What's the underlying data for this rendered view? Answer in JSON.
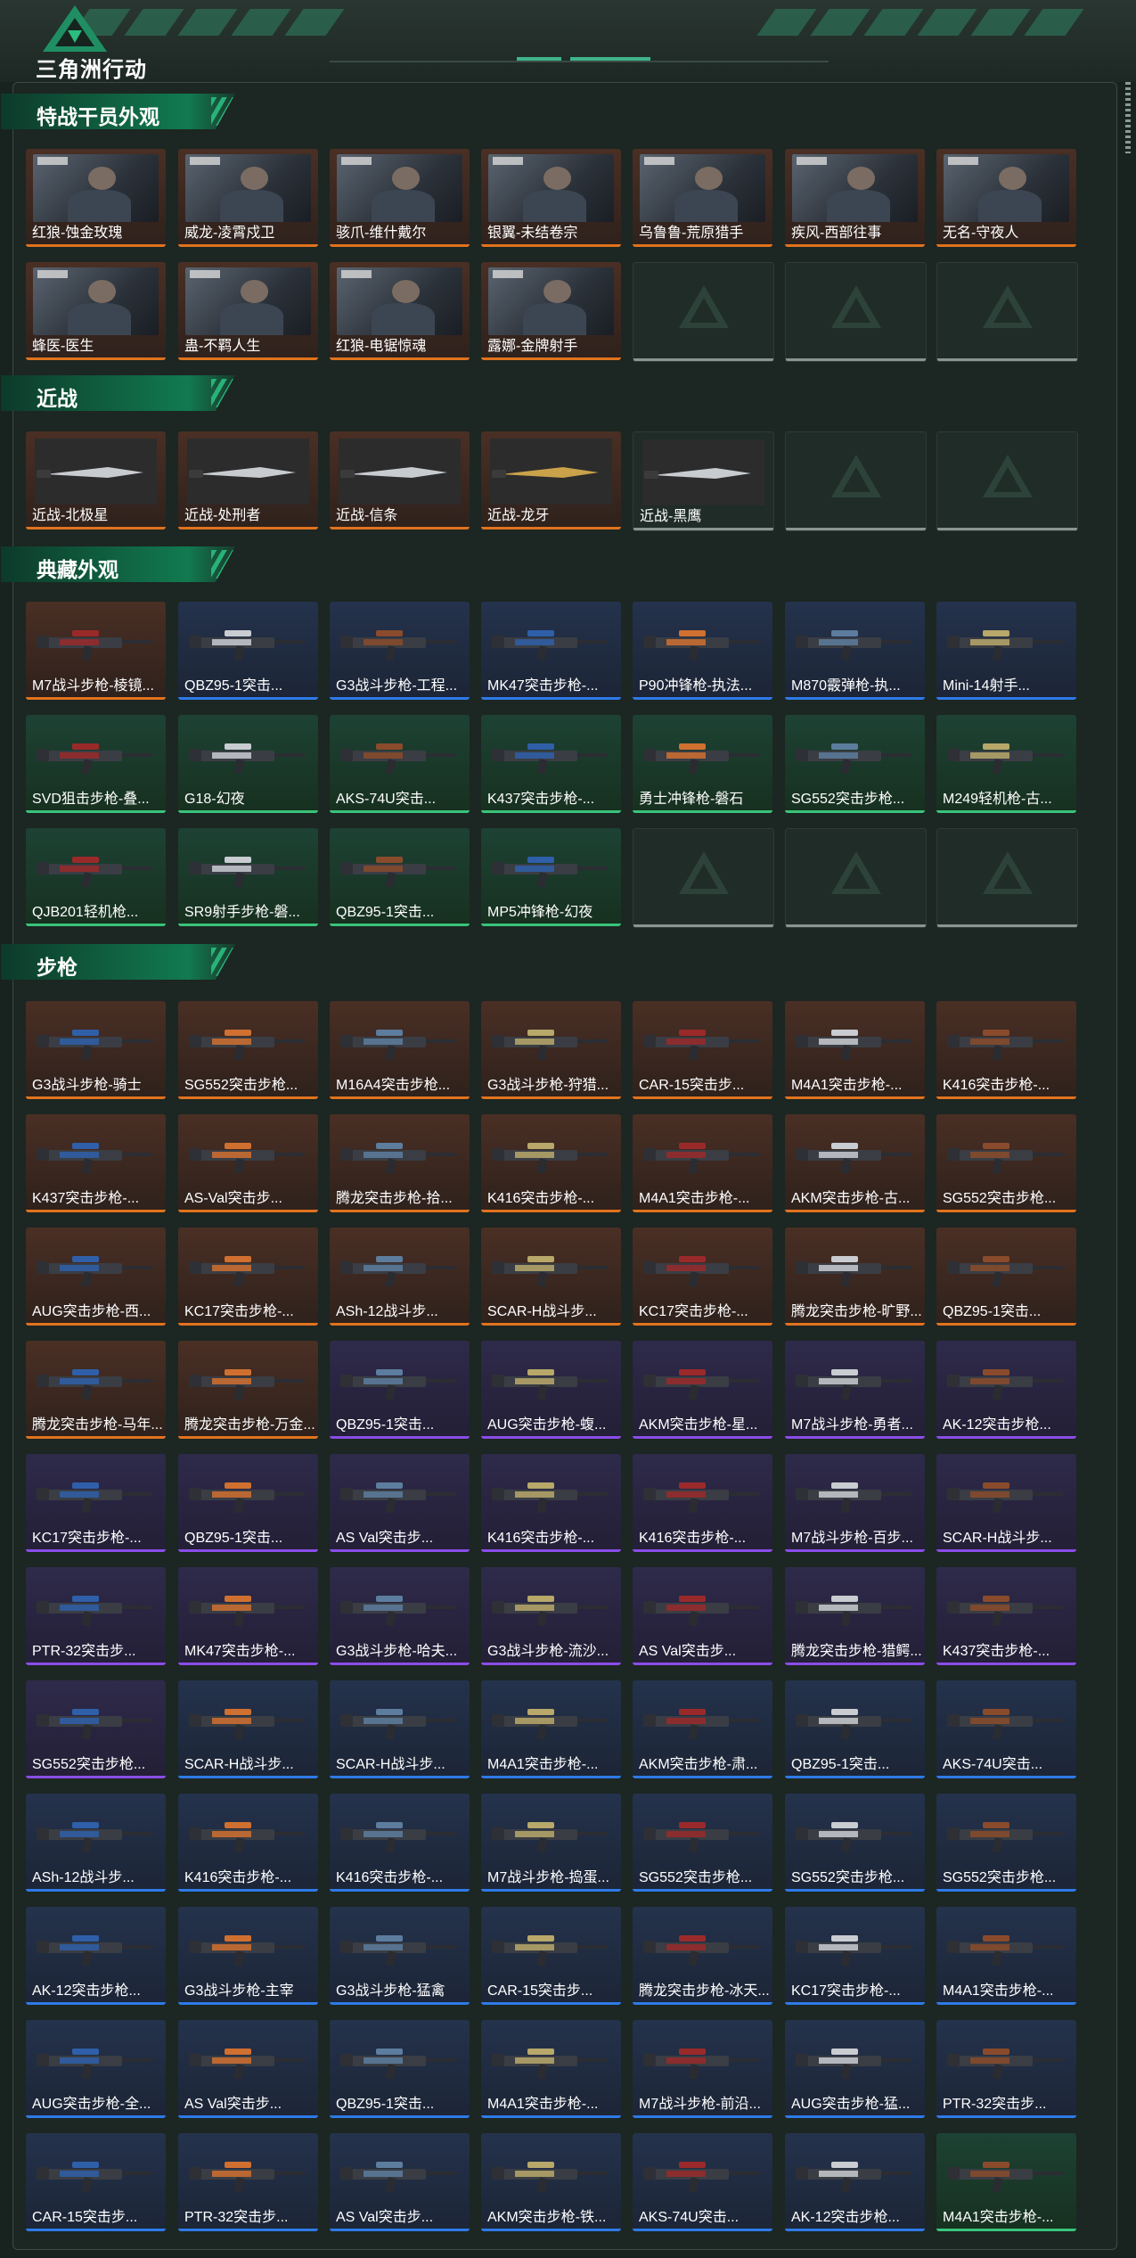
{
  "app": {
    "title": "三角洲行动"
  },
  "sections": [
    {
      "title": "特战干员外观",
      "items": [
        {
          "label": "红狼-蚀金玫瑰",
          "rarity": "orange"
        },
        {
          "label": "威龙-凌霄戍卫",
          "rarity": "orange"
        },
        {
          "label": "骇爪-维什戴尔",
          "rarity": "orange"
        },
        {
          "label": "银翼-未结卷宗",
          "rarity": "orange"
        },
        {
          "label": "乌鲁鲁-荒原猎手",
          "rarity": "orange"
        },
        {
          "label": "疾风-西部往事",
          "rarity": "orange"
        },
        {
          "label": "无名-守夜人",
          "rarity": "orange"
        },
        {
          "label": "蜂医-医生",
          "rarity": "orange"
        },
        {
          "label": "蛊-不羁人生",
          "rarity": "orange"
        },
        {
          "label": "红狼-电锯惊魂",
          "rarity": "orange"
        },
        {
          "label": "露娜-金牌射手",
          "rarity": "orange"
        }
      ]
    },
    {
      "title": "近战",
      "items": [
        {
          "label": "近战-北极星",
          "rarity": "orange"
        },
        {
          "label": "近战-处刑者",
          "rarity": "orange"
        },
        {
          "label": "近战-信条",
          "rarity": "orange"
        },
        {
          "label": "近战-龙牙",
          "rarity": "orange"
        },
        {
          "label": "近战-黑鹰",
          "rarity": "empty"
        }
      ]
    },
    {
      "title": "典藏外观",
      "items": [
        {
          "label": "M7战斗步枪-棱镜...",
          "rarity": "orange"
        },
        {
          "label": "QBZ95-1突击...",
          "rarity": "blue"
        },
        {
          "label": "G3战斗步枪-工程...",
          "rarity": "blue"
        },
        {
          "label": "MK47突击步枪-...",
          "rarity": "blue"
        },
        {
          "label": "P90冲锋枪-执法...",
          "rarity": "blue"
        },
        {
          "label": "M870霰弹枪-执...",
          "rarity": "blue"
        },
        {
          "label": "Mini-14射手...",
          "rarity": "blue"
        },
        {
          "label": "SVD狙击步枪-叠...",
          "rarity": "green"
        },
        {
          "label": "G18-幻夜",
          "rarity": "green"
        },
        {
          "label": "AKS-74U突击...",
          "rarity": "green"
        },
        {
          "label": "K437突击步枪-...",
          "rarity": "green"
        },
        {
          "label": "勇士冲锋枪-磐石",
          "rarity": "green"
        },
        {
          "label": "SG552突击步枪...",
          "rarity": "green"
        },
        {
          "label": "M249轻机枪-古...",
          "rarity": "green"
        },
        {
          "label": "QJB201轻机枪...",
          "rarity": "green"
        },
        {
          "label": "SR9射手步枪-磐...",
          "rarity": "green"
        },
        {
          "label": "QBZ95-1突击...",
          "rarity": "green"
        },
        {
          "label": "MP5冲锋枪-幻夜",
          "rarity": "green"
        }
      ]
    },
    {
      "title": "步枪",
      "items": [
        {
          "label": "G3战斗步枪-骑士",
          "rarity": "orange"
        },
        {
          "label": "SG552突击步枪...",
          "rarity": "orange"
        },
        {
          "label": "M16A4突击步枪...",
          "rarity": "orange"
        },
        {
          "label": "G3战斗步枪-狩猎...",
          "rarity": "orange"
        },
        {
          "label": "CAR-15突击步...",
          "rarity": "orange"
        },
        {
          "label": "M4A1突击步枪-...",
          "rarity": "orange"
        },
        {
          "label": "K416突击步枪-...",
          "rarity": "orange"
        },
        {
          "label": "K437突击步枪-...",
          "rarity": "orange"
        },
        {
          "label": "AS-Val突击步...",
          "rarity": "orange"
        },
        {
          "label": "腾龙突击步枪-拾...",
          "rarity": "orange"
        },
        {
          "label": "K416突击步枪-...",
          "rarity": "orange"
        },
        {
          "label": "M4A1突击步枪-...",
          "rarity": "orange"
        },
        {
          "label": "AKM突击步枪-古...",
          "rarity": "orange"
        },
        {
          "label": "SG552突击步枪...",
          "rarity": "orange"
        },
        {
          "label": "AUG突击步枪-西...",
          "rarity": "orange"
        },
        {
          "label": "KC17突击步枪-...",
          "rarity": "orange"
        },
        {
          "label": "ASh-12战斗步...",
          "rarity": "orange"
        },
        {
          "label": "SCAR-H战斗步...",
          "rarity": "orange"
        },
        {
          "label": "KC17突击步枪-...",
          "rarity": "orange"
        },
        {
          "label": "腾龙突击步枪-旷野...",
          "rarity": "orange"
        },
        {
          "label": "QBZ95-1突击...",
          "rarity": "orange"
        },
        {
          "label": "腾龙突击步枪-马年...",
          "rarity": "orange"
        },
        {
          "label": "腾龙突击步枪-万金...",
          "rarity": "orange"
        },
        {
          "label": "QBZ95-1突击...",
          "rarity": "purple"
        },
        {
          "label": "AUG突击步枪-蝮...",
          "rarity": "purple"
        },
        {
          "label": "AKM突击步枪-星...",
          "rarity": "purple"
        },
        {
          "label": "M7战斗步枪-勇者...",
          "rarity": "purple"
        },
        {
          "label": "AK-12突击步枪...",
          "rarity": "purple"
        },
        {
          "label": "KC17突击步枪-...",
          "rarity": "purple"
        },
        {
          "label": "QBZ95-1突击...",
          "rarity": "purple"
        },
        {
          "label": "AS Val突击步...",
          "rarity": "purple"
        },
        {
          "label": "K416突击步枪-...",
          "rarity": "purple"
        },
        {
          "label": "K416突击步枪-...",
          "rarity": "purple"
        },
        {
          "label": "M7战斗步枪-百步...",
          "rarity": "purple"
        },
        {
          "label": "SCAR-H战斗步...",
          "rarity": "purple"
        },
        {
          "label": "PTR-32突击步...",
          "rarity": "purple"
        },
        {
          "label": "MK47突击步枪-...",
          "rarity": "purple"
        },
        {
          "label": "G3战斗步枪-哈夫...",
          "rarity": "purple"
        },
        {
          "label": "G3战斗步枪-流沙...",
          "rarity": "purple"
        },
        {
          "label": "AS Val突击步...",
          "rarity": "purple"
        },
        {
          "label": "腾龙突击步枪-猎鳄...",
          "rarity": "purple"
        },
        {
          "label": "K437突击步枪-...",
          "rarity": "purple"
        },
        {
          "label": "SG552突击步枪...",
          "rarity": "purple"
        },
        {
          "label": "SCAR-H战斗步...",
          "rarity": "blue"
        },
        {
          "label": "SCAR-H战斗步...",
          "rarity": "blue"
        },
        {
          "label": "M4A1突击步枪-...",
          "rarity": "blue"
        },
        {
          "label": "AKM突击步枪-肃...",
          "rarity": "blue"
        },
        {
          "label": "QBZ95-1突击...",
          "rarity": "blue"
        },
        {
          "label": "AKS-74U突击...",
          "rarity": "blue"
        },
        {
          "label": "ASh-12战斗步...",
          "rarity": "blue"
        },
        {
          "label": "K416突击步枪-...",
          "rarity": "blue"
        },
        {
          "label": "K416突击步枪-...",
          "rarity": "blue"
        },
        {
          "label": "M7战斗步枪-捣蛋...",
          "rarity": "blue"
        },
        {
          "label": "SG552突击步枪...",
          "rarity": "blue"
        },
        {
          "label": "SG552突击步枪...",
          "rarity": "blue"
        },
        {
          "label": "SG552突击步枪...",
          "rarity": "blue"
        },
        {
          "label": "AK-12突击步枪...",
          "rarity": "blue"
        },
        {
          "label": "G3战斗步枪-主宰",
          "rarity": "blue"
        },
        {
          "label": "G3战斗步枪-猛禽",
          "rarity": "blue"
        },
        {
          "label": "CAR-15突击步...",
          "rarity": "blue"
        },
        {
          "label": "腾龙突击步枪-冰天...",
          "rarity": "blue"
        },
        {
          "label": "KC17突击步枪-...",
          "rarity": "blue"
        },
        {
          "label": "M4A1突击步枪-...",
          "rarity": "blue"
        },
        {
          "label": "AUG突击步枪-全...",
          "rarity": "blue"
        },
        {
          "label": "AS Val突击步...",
          "rarity": "blue"
        },
        {
          "label": "QBZ95-1突击...",
          "rarity": "blue"
        },
        {
          "label": "M4A1突击步枪-...",
          "rarity": "blue"
        },
        {
          "label": "M7战斗步枪-前沿...",
          "rarity": "blue"
        },
        {
          "label": "AUG突击步枪-猛...",
          "rarity": "blue"
        },
        {
          "label": "PTR-32突击步...",
          "rarity": "blue"
        },
        {
          "label": "CAR-15突击步...",
          "rarity": "blue"
        },
        {
          "label": "PTR-32突击步...",
          "rarity": "blue"
        },
        {
          "label": "AS Val突击步...",
          "rarity": "blue"
        },
        {
          "label": "AKM突击步枪-铁...",
          "rarity": "blue"
        },
        {
          "label": "AKS-74U突击...",
          "rarity": "blue"
        },
        {
          "label": "AK-12突击步枪...",
          "rarity": "blue"
        },
        {
          "label": "M4A1突击步枪-...",
          "rarity": "green"
        }
      ]
    }
  ],
  "colors": {
    "accent": "#2bbd7e",
    "orange": "#e0731e",
    "purple": "#8a4de8",
    "blue": "#2e7ae8",
    "green": "#39c47a"
  }
}
